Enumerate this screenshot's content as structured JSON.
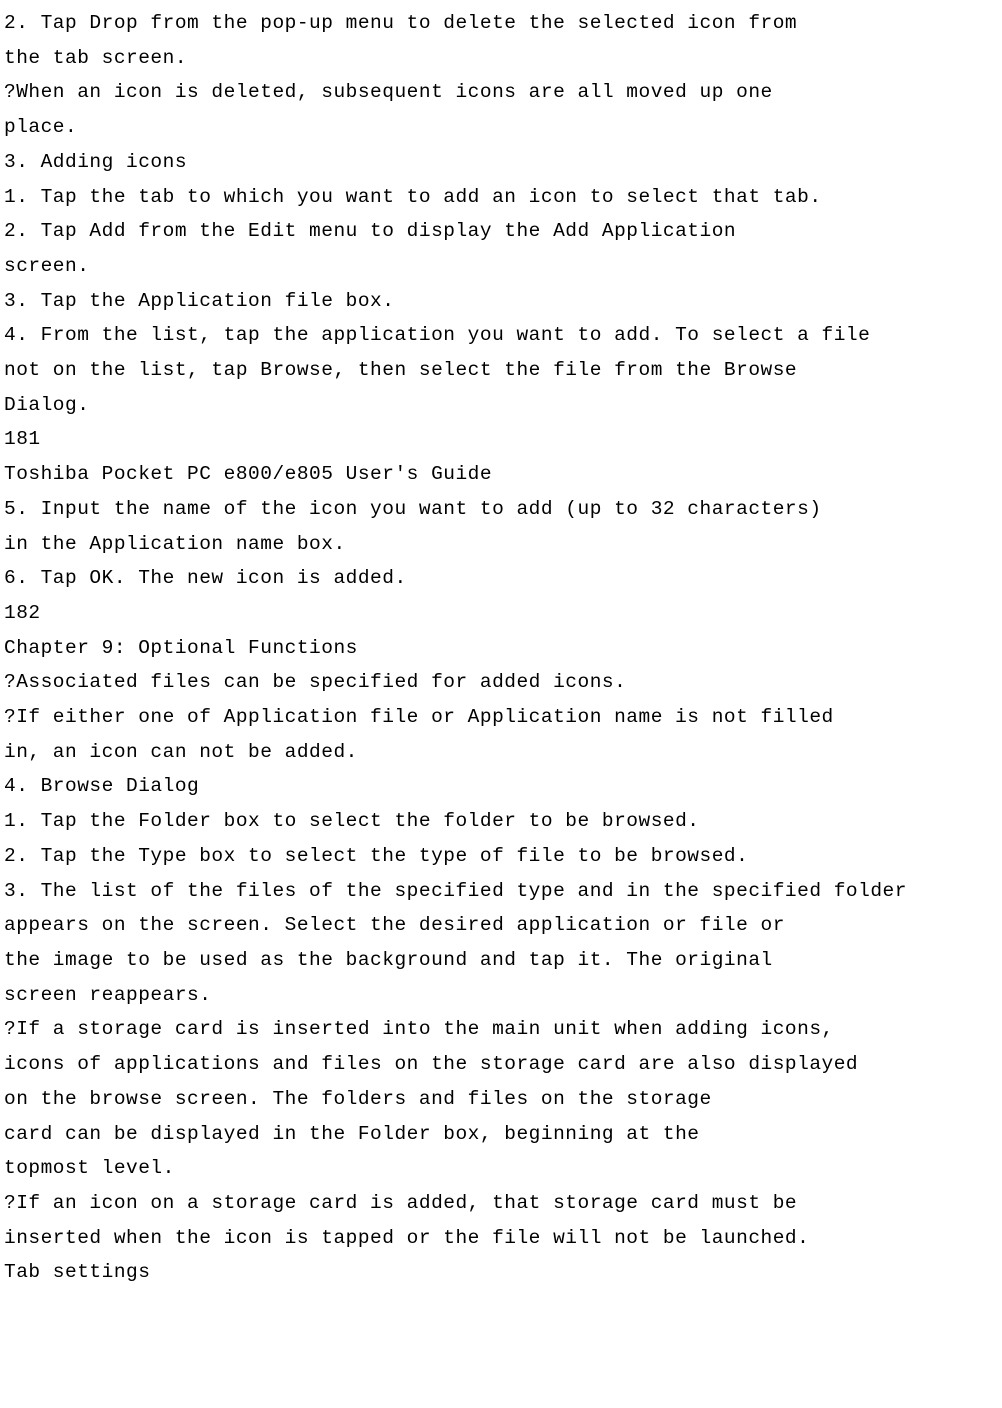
{
  "lines": [
    "2. Tap Drop from the pop-up menu to delete the selected icon from",
    "the tab screen.",
    "?When an icon is deleted, subsequent icons are all moved up one",
    "place.",
    "3. Adding icons",
    "1. Tap the tab to which you want to add an icon to select that tab.",
    "2. Tap Add from the Edit menu to display the Add Application",
    "screen.",
    "3. Tap the Application file box.",
    "4. From the list, tap the application you want to add. To select a file",
    "not on the list, tap Browse, then select the file from the Browse",
    "Dialog.",
    "181",
    "Toshiba Pocket PC e800/e805 User's Guide",
    "5. Input the name of the icon you want to add (up to 32 characters)",
    "in the Application name box.",
    "6. Tap OK. The new icon is added.",
    "182",
    "Chapter 9: Optional Functions",
    "?Associated files can be specified for added icons.",
    "?If either one of Application file or Application name is not filled",
    "in, an icon can not be added.",
    "4. Browse Dialog",
    "1. Tap the Folder box to select the folder to be browsed.",
    "2. Tap the Type box to select the type of file to be browsed.",
    "3. The list of the files of the specified type and in the specified folder",
    "appears on the screen. Select the desired application or file or",
    "the image to be used as the background and tap it. The original",
    "screen reappears.",
    "?If a storage card is inserted into the main unit when adding icons,",
    "icons of applications and files on the storage card are also displayed",
    "on the browse screen. The folders and files on the storage",
    "card can be displayed in the Folder box, beginning at the",
    "topmost level.",
    "?If an icon on a storage card is added, that storage card must be",
    "inserted when the icon is tapped or the file will not be launched.",
    "Tab settings"
  ]
}
